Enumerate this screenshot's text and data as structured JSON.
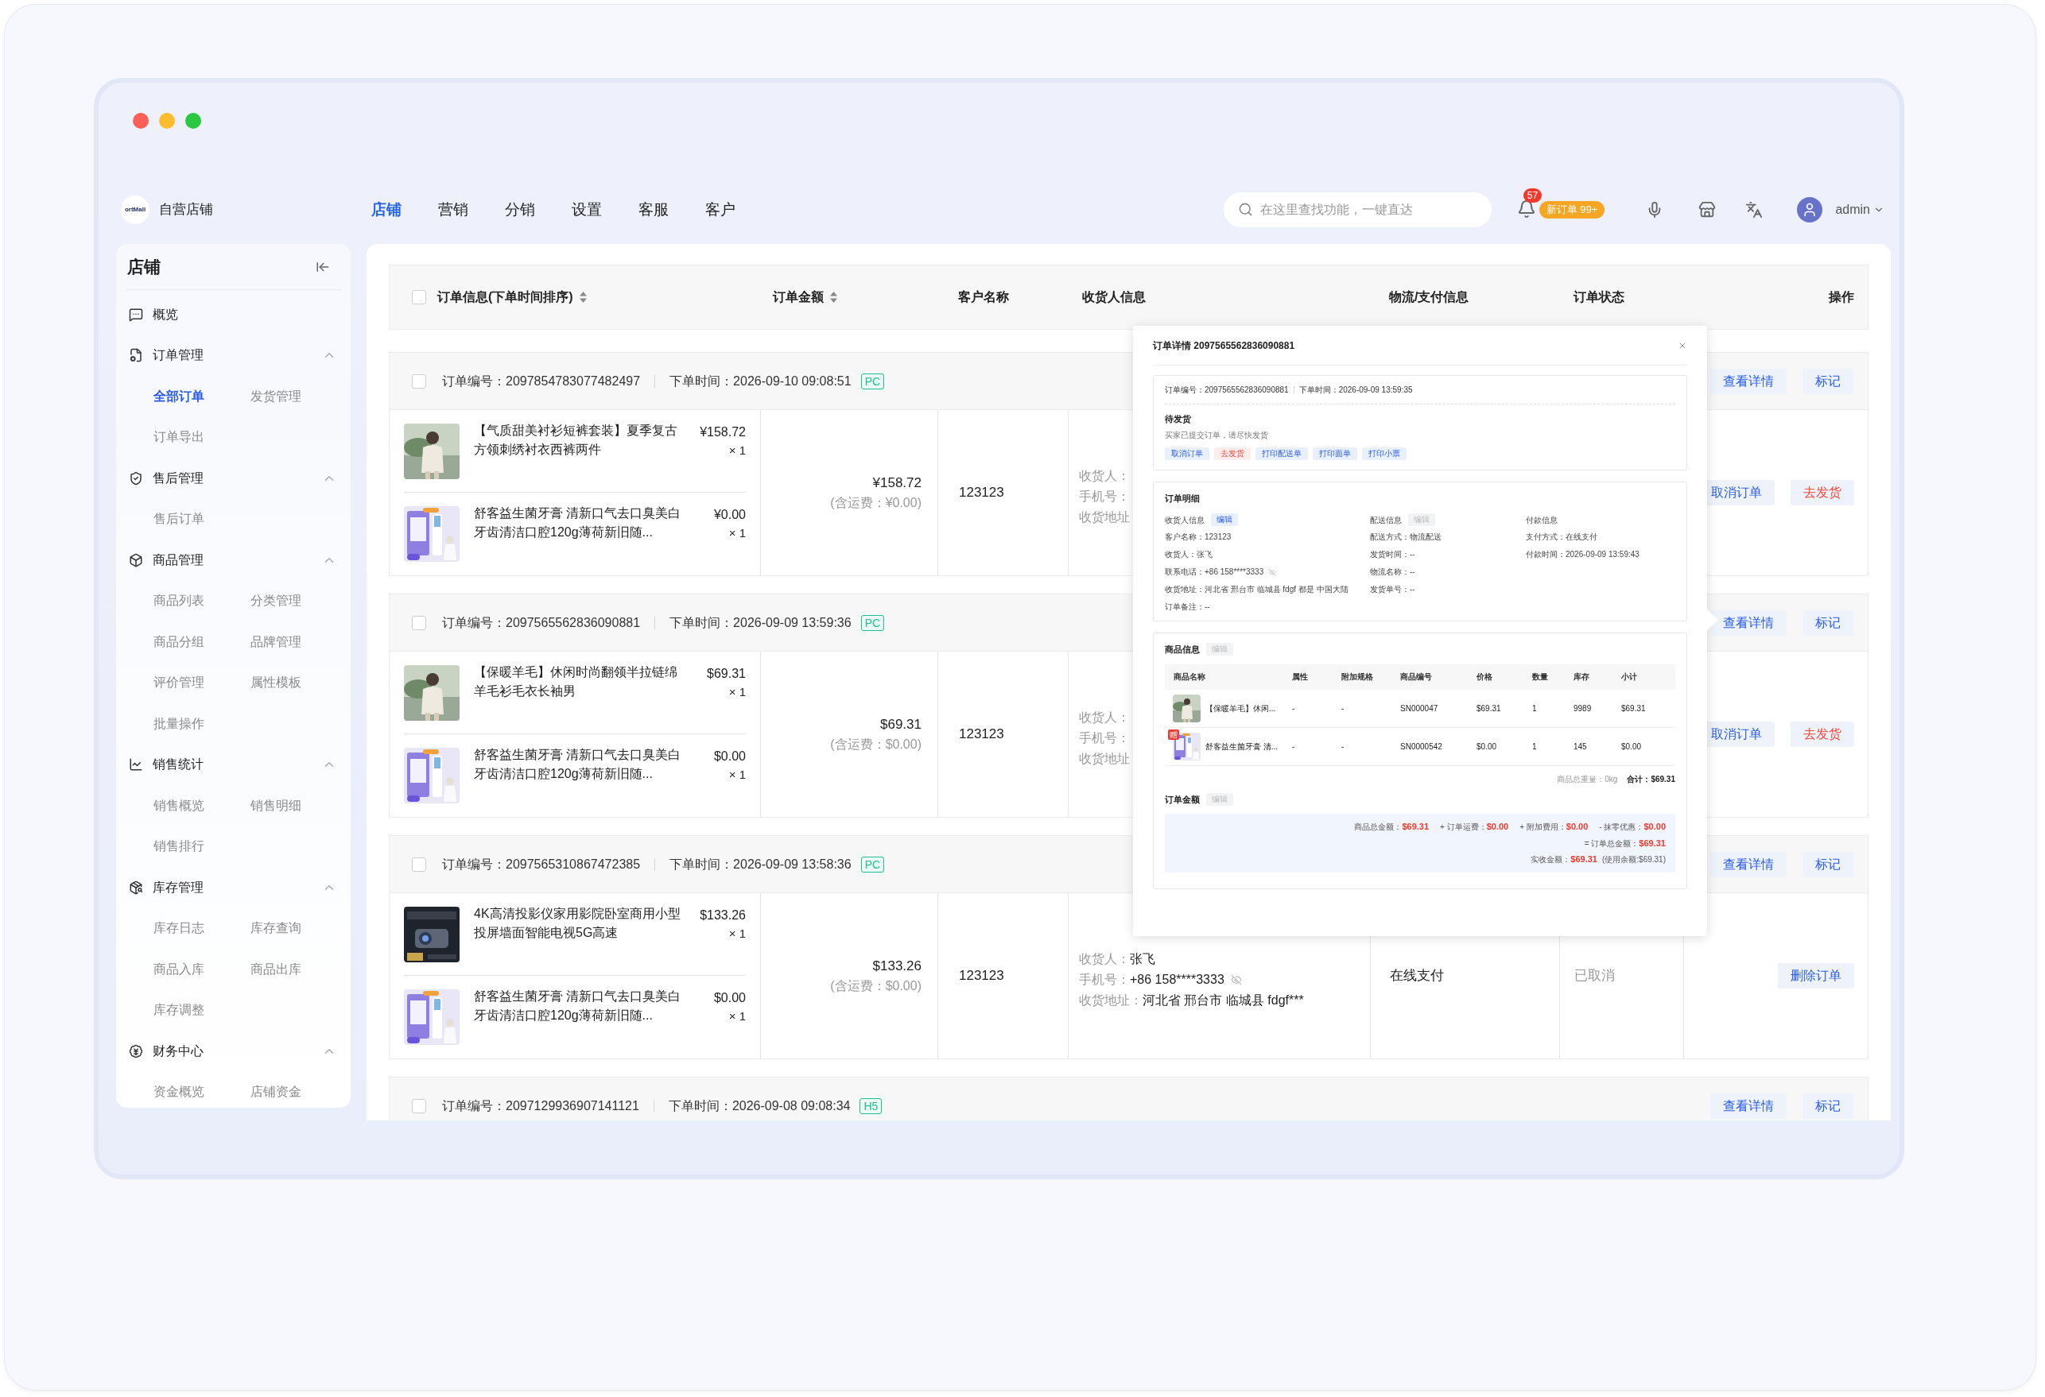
{
  "topbar": {
    "logo_text": "ortMall",
    "shop_name": "自营店铺",
    "nav": [
      {
        "label": "店铺",
        "selected": true
      },
      {
        "label": "营销",
        "selected": false
      },
      {
        "label": "分销",
        "selected": false
      },
      {
        "label": "设置",
        "selected": false
      },
      {
        "label": "客服",
        "selected": false
      },
      {
        "label": "客户",
        "selected": false
      }
    ],
    "search": {
      "placeholder": "在这里查找功能，一键直达"
    },
    "notification_count": "57",
    "new_orders": "新订单 99+",
    "user": "admin"
  },
  "sidebar": {
    "title": "店铺",
    "groups": [
      {
        "label": "概览",
        "kind": "chat"
      },
      {
        "label": "订单管理",
        "kind": "document",
        "expanded": true,
        "children": [
          {
            "label": "全部订单",
            "selected": true
          },
          {
            "label": "发货管理",
            "selected": false
          },
          {
            "label": "订单导出",
            "selected": false
          }
        ]
      },
      {
        "label": "售后管理",
        "kind": "shield",
        "expanded": true,
        "children": [
          {
            "label": "售后订单",
            "selected": false
          }
        ]
      },
      {
        "label": "商品管理",
        "kind": "box",
        "expanded": true,
        "children": [
          {
            "label": "商品列表",
            "selected": false
          },
          {
            "label": "分类管理",
            "selected": false
          },
          {
            "label": "商品分组",
            "selected": false
          },
          {
            "label": "品牌管理",
            "selected": false
          },
          {
            "label": "评价管理",
            "selected": false
          },
          {
            "label": "属性模板",
            "selected": false
          },
          {
            "label": "批量操作",
            "selected": false
          }
        ]
      },
      {
        "label": "销售统计",
        "kind": "chart",
        "expanded": true,
        "children": [
          {
            "label": "销售概览",
            "selected": false
          },
          {
            "label": "销售明细",
            "selected": false
          },
          {
            "label": "销售排行",
            "selected": false
          }
        ]
      },
      {
        "label": "库存管理",
        "kind": "boxes",
        "expanded": true,
        "children": [
          {
            "label": "库存日志",
            "selected": false
          },
          {
            "label": "库存查询",
            "selected": false
          },
          {
            "label": "商品入库",
            "selected": false
          },
          {
            "label": "商品出库",
            "selected": false
          },
          {
            "label": "库存调整",
            "selected": false
          }
        ]
      },
      {
        "label": "财务中心",
        "kind": "yen",
        "expanded": true,
        "children": [
          {
            "label": "资金概览",
            "selected": false
          },
          {
            "label": "店铺资金",
            "selected": false
          }
        ]
      }
    ]
  },
  "table": {
    "select_all_checked": false,
    "columns": [
      {
        "label": "订单信息(下单时间排序)",
        "sortable": true
      },
      {
        "label": "订单金额",
        "sortable": true
      },
      {
        "label": "客户名称",
        "sortable": false
      },
      {
        "label": "收货人信息",
        "sortable": false
      },
      {
        "label": "物流/支付信息",
        "sortable": false
      },
      {
        "label": "订单状态",
        "sortable": false
      },
      {
        "label": "操作",
        "sortable": false
      }
    ],
    "orders": [
      {
        "checked": false,
        "number_label": "订单编号：",
        "number": "2097854783077482497",
        "time_label": "下单时间：",
        "time": "2026-09-10 09:08:51",
        "channel": "PC",
        "header_actions": [
          {
            "label": "查看详情",
            "kind": "primary"
          },
          {
            "label": "标记",
            "kind": "primary"
          }
        ],
        "items": [
          {
            "name": "【气质甜美衬衫短裤套装】夏季复古方领刺绣衬衣西裤两件",
            "price": "¥158.72",
            "qty": "× 1"
          },
          {
            "name": "舒客益生菌牙膏 清新口气去口臭美白牙齿清洁口腔120g薄荷新旧随...",
            "price": "¥0.00",
            "qty": "× 1"
          }
        ],
        "amount": "¥158.72",
        "shipping": "(含运费：¥0.00)",
        "customer": "123123",
        "receiver": [
          {
            "label": "收货人："
          },
          {
            "label": "手机号："
          },
          {
            "label": "收货地址"
          }
        ],
        "actions": [
          {
            "label": "取消订单",
            "kind": "primary"
          },
          {
            "label": "去发货",
            "kind": "danger"
          }
        ]
      },
      {
        "checked": false,
        "number_label": "订单编号：",
        "number": "2097565562836090881",
        "time_label": "下单时间：",
        "time": "2026-09-09 13:59:36",
        "channel": "PC",
        "header_actions": [
          {
            "label": "查看详情",
            "kind": "primary"
          },
          {
            "label": "标记",
            "kind": "primary"
          }
        ],
        "items": [
          {
            "name": "【保暖羊毛】休闲时尚翻领半拉链绵羊毛衫毛衣长袖男",
            "price": "$69.31",
            "qty": "× 1"
          },
          {
            "name": "舒客益生菌牙膏 清新口气去口臭美白牙齿清洁口腔120g薄荷新旧随...",
            "price": "$0.00",
            "qty": "× 1"
          }
        ],
        "amount": "$69.31",
        "shipping": "(含运费：$0.00)",
        "customer": "123123",
        "receiver": [
          {
            "label": "收货人："
          },
          {
            "label": "手机号："
          },
          {
            "label": "收货地址"
          }
        ],
        "actions": [
          {
            "label": "取消订单",
            "kind": "primary"
          },
          {
            "label": "去发货",
            "kind": "danger"
          }
        ]
      },
      {
        "checked": false,
        "number_label": "订单编号：",
        "number": "2097565310867472385",
        "time_label": "下单时间：",
        "time": "2026-09-09 13:58:36",
        "channel": "PC",
        "header_actions": [
          {
            "label": "查看详情",
            "kind": "primary"
          },
          {
            "label": "标记",
            "kind": "primary"
          }
        ],
        "items": [
          {
            "name": "4K高清投影仪家用影院卧室商用小型投屏墙面智能电视5G高速",
            "price": "$133.26",
            "qty": "× 1"
          },
          {
            "name": "舒客益生菌牙膏 清新口气去口臭美白牙齿清洁口腔120g薄荷新旧随...",
            "price": "$0.00",
            "qty": "× 1"
          }
        ],
        "amount": "$133.26",
        "shipping": "(含运费：$0.00)",
        "customer": "123123",
        "receiver": [
          {
            "label": "收货人：",
            "value": "张飞",
            "kind": "text"
          },
          {
            "label": "手机号：",
            "value": "+86  158****3333",
            "kind": "phone"
          },
          {
            "label": "收货地址：",
            "value": "河北省 邢台市 临城县 fdgf***",
            "kind": "text"
          }
        ],
        "payment": "在线支付",
        "status": "已取消",
        "actions": [
          {
            "label": "删除订单",
            "kind": "primary"
          }
        ]
      },
      {
        "checked": false,
        "number_label": "订单编号：",
        "number": "2097129936907141121",
        "time_label": "下单时间：",
        "time": "2026-09-08 09:08:34",
        "channel": "H5",
        "header_actions": [
          {
            "label": "查看详情",
            "kind": "primary"
          },
          {
            "label": "标记",
            "kind": "primary"
          }
        ]
      }
    ]
  },
  "popup": {
    "title": "订单详情 2097565562836090881",
    "summary": {
      "number_label": "订单编号：",
      "number": "2097565562836090881",
      "time_label": "下单时间：",
      "time": "2026-09-09 13:59:35",
      "status": "待发货",
      "status_note": "买家已提交订单，请尽快发货",
      "buttons": [
        {
          "label": "取消订单",
          "kind": "primary"
        },
        {
          "label": "去发货",
          "kind": "danger"
        },
        {
          "label": "打印配送单",
          "kind": "primary"
        },
        {
          "label": "打印面单",
          "kind": "primary"
        },
        {
          "label": "打印小票",
          "kind": "primary"
        }
      ]
    },
    "detail": {
      "title": "订单明细",
      "sections": [
        {
          "title": "收货人信息",
          "edit": {
            "label": "编辑",
            "disabled": false
          },
          "fields": [
            {
              "label": "客户名称：",
              "value": "123123"
            },
            {
              "label": "收货人：",
              "value": "张飞"
            },
            {
              "label": "联系电话：",
              "value": "+86  158****3333",
              "kind": "phone"
            },
            {
              "label": "收货地址：",
              "value": "河北省 邢台市 临城县 fdgf 都是 中国大陆"
            },
            {
              "label": "订单备注：",
              "value": "--"
            }
          ]
        },
        {
          "title": "配送信息",
          "edit": {
            "label": "编辑",
            "disabled": true
          },
          "fields": [
            {
              "label": "配送方式：",
              "value": "物流配送"
            },
            {
              "label": "发货时间：",
              "value": "--"
            },
            {
              "label": "物流名称：",
              "value": "--"
            },
            {
              "label": "发货单号：",
              "value": "--"
            }
          ]
        },
        {
          "title": "付款信息",
          "fields": [
            {
              "label": "支付方式：",
              "value": "在线支付"
            },
            {
              "label": "付款时间：",
              "value": "2026-09-09 13:59:43"
            }
          ]
        }
      ]
    },
    "goods": {
      "title": "商品信息",
      "edit": {
        "label": "编辑",
        "disabled": true
      },
      "columns": [
        "商品名称",
        "属性",
        "附加规格",
        "商品编号",
        "价格",
        "数量",
        "库存",
        "小计"
      ],
      "rows": [
        {
          "name": "【保暖羊毛】休闲...",
          "attr": "-",
          "extra": "-",
          "sku": "SN000047",
          "price": "$69.31",
          "qty": "1",
          "stock": "9989",
          "subtotal": "$69.31"
        },
        {
          "badge": "赠",
          "name": "舒客益生菌牙膏 清...",
          "attr": "-",
          "extra": "-",
          "sku": "SN0000542",
          "price": "$0.00",
          "qty": "1",
          "stock": "145",
          "subtotal": "$0.00"
        }
      ],
      "weight_label": "商品总重量：",
      "weight": "0kg",
      "total_label": "合计：",
      "total": "$69.31"
    },
    "amount": {
      "title": "订单金额",
      "edit": {
        "label": "编辑",
        "disabled": true
      },
      "lines": [
        [
          {
            "label": "商品总金额：",
            "value": "$69.31"
          },
          {
            "label": "+ 订单运费：",
            "value": "$0.00"
          },
          {
            "label": "+ 附加费用：",
            "value": "$0.00"
          },
          {
            "label": "- 抹零优惠：",
            "value": "$0.00"
          }
        ],
        [
          {
            "label": "= 订单总金额：",
            "value": "$69.31"
          }
        ],
        [
          {
            "label": "实收金额：",
            "value": "$69.31",
            "note": "(使用余额:$69.31)"
          }
        ]
      ]
    }
  }
}
